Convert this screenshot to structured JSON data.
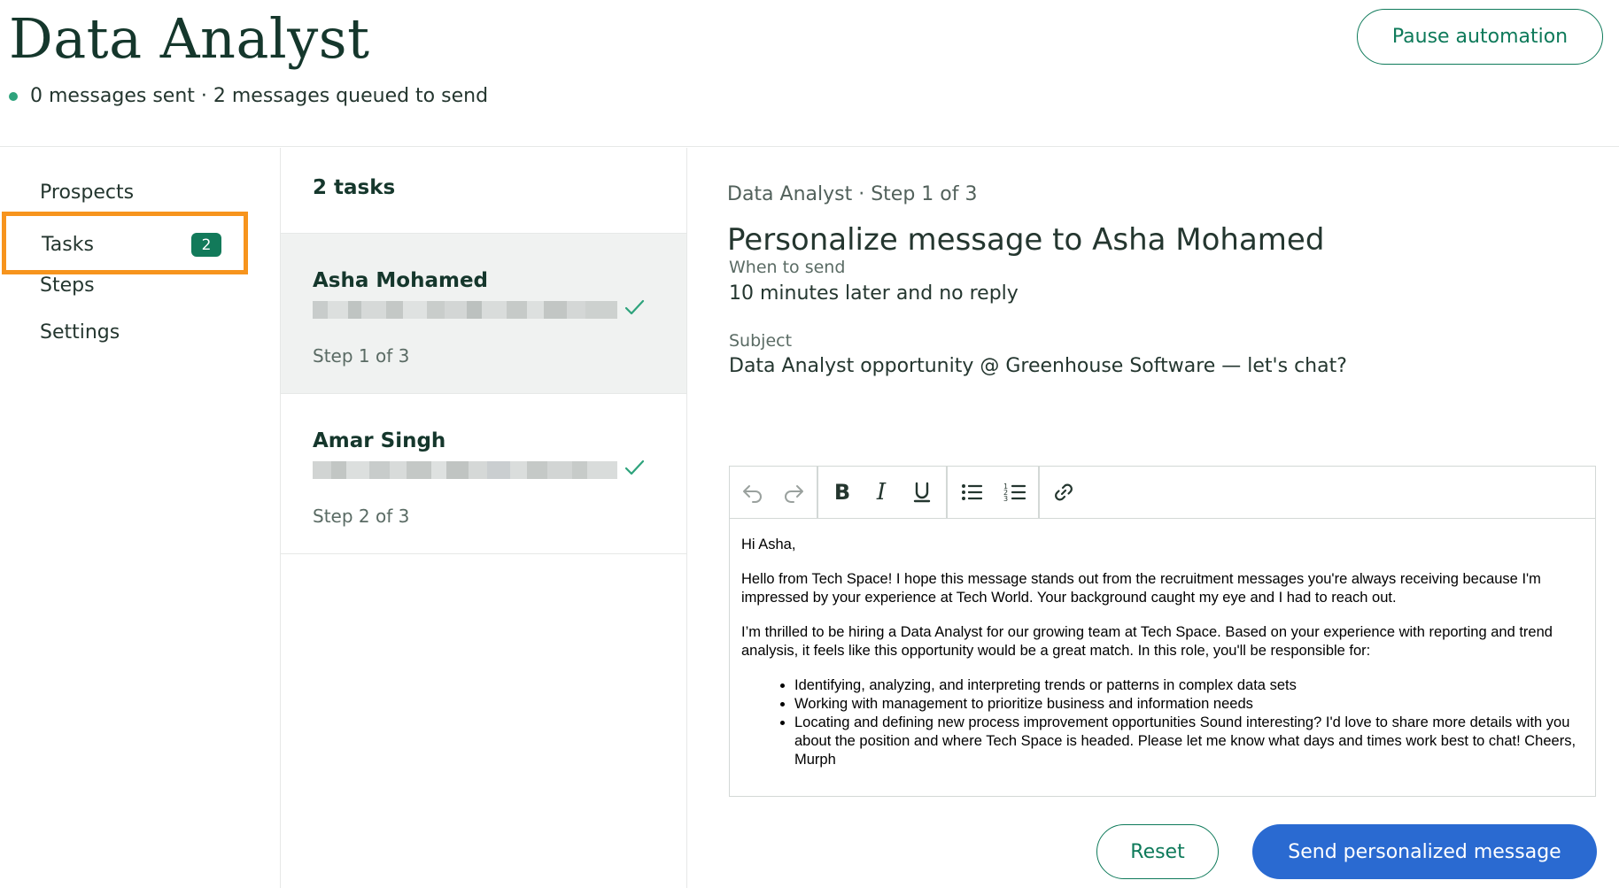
{
  "header": {
    "title": "Data Analyst",
    "status": "0 messages sent · 2 messages queued to send",
    "pause_label": "Pause automation"
  },
  "sidebar": {
    "items": [
      {
        "label": "Prospects"
      },
      {
        "label": "Tasks",
        "badge": "2",
        "highlighted": true
      },
      {
        "label": "Steps"
      },
      {
        "label": "Settings"
      }
    ]
  },
  "tasklist": {
    "count_label": "2 tasks",
    "tasks": [
      {
        "name": "Asha Mohamed",
        "step": "Step 1 of 3",
        "selected": true,
        "email_redacted": true
      },
      {
        "name": "Amar Singh",
        "step": "Step 2 of 3",
        "selected": false,
        "email_redacted": true
      }
    ]
  },
  "main": {
    "breadcrumb": "Data Analyst · Step 1 of 3",
    "title": "Personalize message to Asha Mohamed",
    "when_label": "When to send",
    "when_value": "10 minutes later and no reply",
    "subject_label": "Subject",
    "subject_value": "Data Analyst opportunity @ Greenhouse Software — let's chat?",
    "toolbar_icons": [
      "undo-icon",
      "redo-icon",
      "bold-icon",
      "italic-icon",
      "underline-icon",
      "bulleted-list-icon",
      "numbered-list-icon",
      "link-icon"
    ],
    "message": {
      "greeting": "Hi Asha,",
      "para1": "Hello from Tech Space! I hope this message stands out from the recruitment messages you're always receiving because I'm impressed by your experience at Tech World. Your background caught my eye and I had to reach out.",
      "para2": "I’m thrilled to be hiring a Data Analyst for our growing team at Tech Space. Based on your experience with reporting and trend analysis, it feels like this opportunity would be a great match. In this role, you'll be responsible for:",
      "bullets": [
        "Identifying, analyzing, and interpreting trends or patterns in complex data sets",
        "Working with management to prioritize business and information needs",
        "Locating and defining new process improvement opportunities Sound interesting? I'd love to share more details with you about the position and where Tech Space is headed. Please let me know what days and times work best to chat! Cheers, Murph"
      ]
    },
    "reset_label": "Reset",
    "send_label": "Send personalized message"
  },
  "colors": {
    "brand_green": "#0e7a5a",
    "title_green": "#15372c",
    "badge_green": "#127a5a",
    "highlight_orange": "#f7941d",
    "primary_blue": "#2a6ad1",
    "selected_bg": "#f0f2f1"
  }
}
